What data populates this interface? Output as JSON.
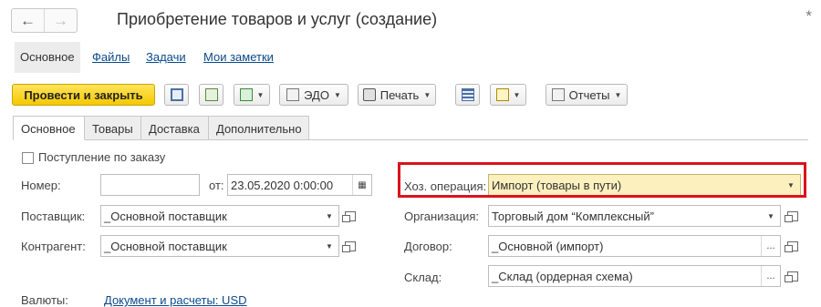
{
  "window": {
    "title": "Приобретение товаров и услуг (создание)",
    "modified_mark": "*"
  },
  "nav": {
    "back": "←",
    "forward": "→"
  },
  "sections": [
    "Основное",
    "Файлы",
    "Задачи",
    "Мои заметки"
  ],
  "toolbar": {
    "post_close": "Провести и закрыть",
    "edo": "ЭДО",
    "print": "Печать",
    "reports": "Отчеты"
  },
  "tabs": [
    "Основное",
    "Товары",
    "Доставка",
    "Дополнительно"
  ],
  "form": {
    "by_order_label": "Поступление по заказу",
    "number_label": "Номер:",
    "number_value": "",
    "date_from_label": "от:",
    "date_value": "23.05.2020  0:00:00",
    "supplier_label": "Поставщик:",
    "supplier_value": "_Основной поставщик",
    "counterparty_label": "Контрагент:",
    "counterparty_value": "_Основной поставщик",
    "currency_label": "Валюты:",
    "currency_link": "Документ и расчеты: USD",
    "operation_label": "Хоз. операция:",
    "operation_value": "Импорт (товары в пути)",
    "organization_label": "Организация:",
    "organization_value": "Торговый дом “Комплексный”",
    "contract_label": "Договор:",
    "contract_value": "_Основной (импорт)",
    "warehouse_label": "Склад:",
    "warehouse_value": "_Склад (ордерная схема)"
  },
  "colors": {
    "primary_button": "#f5c800",
    "highlight_field": "#fdf0bf",
    "annotation_box": "#d9131c",
    "link": "#0a4a8a"
  }
}
